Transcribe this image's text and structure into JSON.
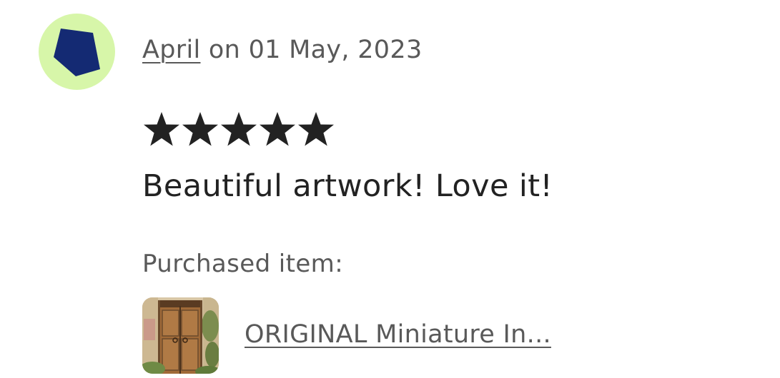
{
  "review": {
    "author": "April",
    "date_prefix": " on ",
    "date": "01 May, 2023",
    "rating": 5,
    "rating_max": 5,
    "text": "Beautiful artwork! Love it!"
  },
  "purchase": {
    "label": "Purchased item:",
    "item_title": "ORIGINAL Miniature In...",
    "thumbnail_icon": "wooden-door-painting"
  },
  "colors": {
    "avatar_bg": "#d7f6a9",
    "avatar_shape": "#142a73",
    "star": "#222222",
    "muted_text": "#595959"
  }
}
